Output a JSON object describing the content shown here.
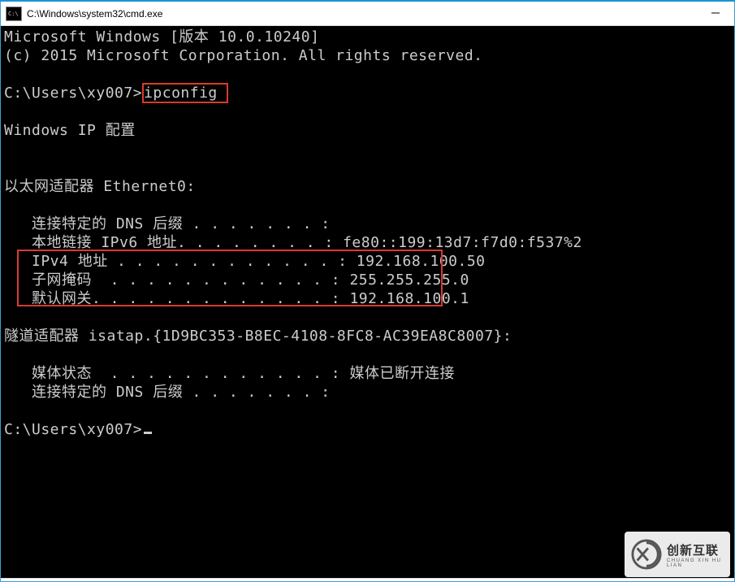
{
  "window": {
    "title": "C:\\Windows\\system32\\cmd.exe"
  },
  "terminal": {
    "header1": "Microsoft Windows [版本 10.0.10240]",
    "header2": "(c) 2015 Microsoft Corporation. All rights reserved.",
    "prompt1": "C:\\Users\\xy007>",
    "command": "ipconfig ",
    "section_title": "Windows IP 配置",
    "adapter1_title": "以太网适配器 Ethernet0:",
    "adapter1_line1": "   连接特定的 DNS 后缀 . . . . . . . :",
    "adapter1_line2": "   本地链接 IPv6 地址. . . . . . . . : fe80::199:13d7:f7d0:f537%2",
    "adapter1_line3": "   IPv4 地址 . . . . . . . . . . . . : 192.168.100.50",
    "adapter1_line4": "   子网掩码  . . . . . . . . . . . . : 255.255.255.0",
    "adapter1_line5": "   默认网关. . . . . . . . . . . . . : 192.168.100.1",
    "adapter2_title": "隧道适配器 isatap.{1D9BC353-B8EC-4108-8FC8-AC39EA8C8007}:",
    "adapter2_line1": "   媒体状态  . . . . . . . . . . . . : 媒体已断开连接",
    "adapter2_line2": "   连接特定的 DNS 后缀 . . . . . . . :",
    "prompt2": "C:\\Users\\xy007>"
  },
  "ip_values": {
    "ipv4": "192.168.100.50",
    "subnet_mask": "255.255.255.0",
    "default_gateway": "192.168.100.1",
    "ipv6_link_local": "fe80::199:13d7:f7d0:f537%2"
  },
  "watermark": {
    "cn": "创新互联",
    "en": "CHUANG XIN HU LIAN"
  }
}
